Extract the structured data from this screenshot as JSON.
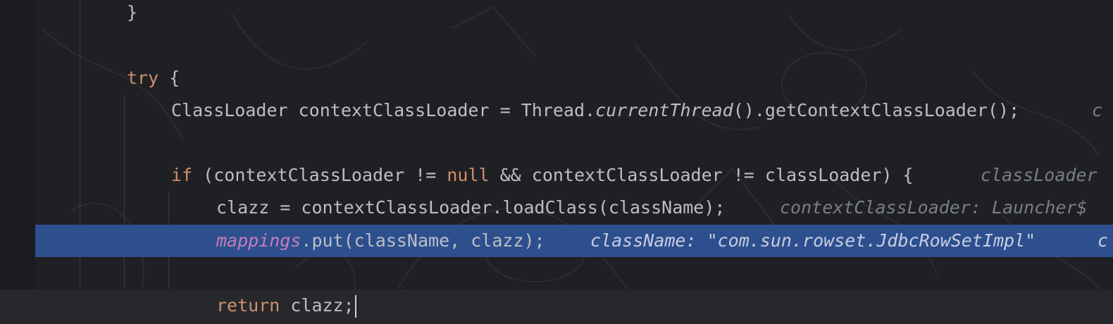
{
  "editor": {
    "lines": [
      {
        "text": "}"
      },
      {
        "keyword": "try",
        "brace": " {"
      },
      {
        "type": "ClassLoader contextClassLoader = Thread.",
        "italic": "currentThread",
        "rest": "().getContextClassLoader();",
        "hint": "c"
      },
      {
        "kw_if": "if",
        "part1": " (contextClassLoader != ",
        "kw_null": "null",
        "part2": " && contextClassLoader != classLoader) {",
        "hint": "classLoader"
      },
      {
        "text": "clazz = contextClassLoader.loadClass(className);",
        "hint": "contextClassLoader: Launcher$"
      },
      {
        "field": "mappings",
        "rest": ".put(className, clazz);",
        "hint": "className: \"com.sun.rowset.JdbcRowSetImpl\"",
        "hint2": "c"
      },
      {
        "keyword": "return",
        "rest": " clazz;"
      }
    ]
  },
  "colors": {
    "background": "#1f2023",
    "highlight": "#2d4f8e",
    "keyword": "#cf8e6d",
    "field": "#c77dbb",
    "hint": "#7a7e85",
    "text": "#bcbec4"
  }
}
